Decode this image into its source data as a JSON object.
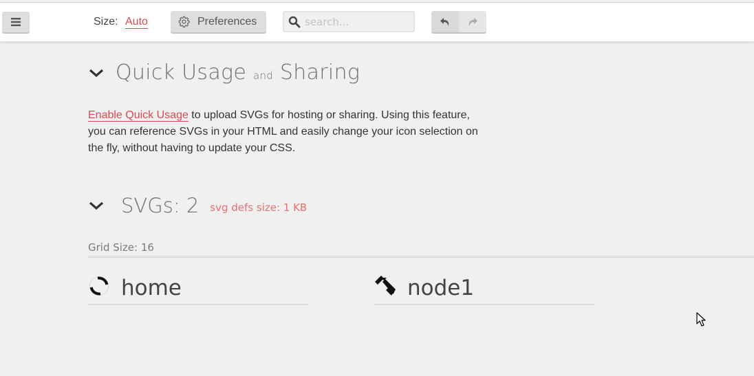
{
  "toolbar": {
    "menu_icon": "hamburger-menu-icon",
    "size_label": "Size:",
    "size_value": "Auto",
    "preferences_label": "Preferences",
    "preferences_icon": "gear-icon",
    "search_placeholder": "search...",
    "search_value": "",
    "search_icon": "search-icon",
    "undo_icon": "undo-icon",
    "redo_icon": "redo-icon"
  },
  "quick_usage": {
    "title_part1": "Quick Usage",
    "title_and": "and",
    "title_part2": "Sharing",
    "link_text": "Enable Quick Usage",
    "description": " to upload SVGs for hosting or sharing. Using this feature, you can reference SVGs in your HTML and easily change your icon selection on the fly, without having to update your CSS."
  },
  "svgs": {
    "title": "SVGs: 2",
    "defs_size": "svg defs size: 1 KB",
    "grid_size": "Grid Size: 16",
    "items": [
      {
        "name": "home",
        "icon": "spinner-circle-icon"
      },
      {
        "name": "node1",
        "icon": "hammer-icon"
      }
    ]
  },
  "colors": {
    "accent": "#e0474c",
    "defs_text": "#e8716e",
    "background": "#f0f0f0",
    "toolbar_bg": "#ffffff"
  }
}
